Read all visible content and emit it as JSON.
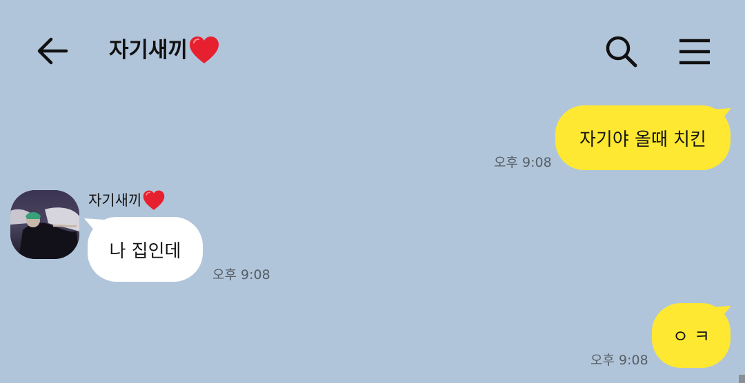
{
  "header": {
    "title": "자기새끼",
    "back_icon": "arrow-left-icon",
    "search_icon": "search-icon",
    "menu_icon": "hamburger-menu-icon"
  },
  "messages": [
    {
      "direction": "out",
      "text": "자기야 올때 치킨",
      "time": "오후 9:08"
    },
    {
      "direction": "in",
      "sender": "자기새끼",
      "text": "나 집인데",
      "time": "오후 9:08"
    },
    {
      "direction": "out",
      "text": "ㅇ ㅋ",
      "time": "오후 9:08"
    }
  ],
  "colors": {
    "background": "#b1c5da",
    "outgoing_bubble": "#fee832",
    "incoming_bubble": "#ffffff",
    "heart": "#e6202e",
    "timestamp": "#565e66"
  }
}
